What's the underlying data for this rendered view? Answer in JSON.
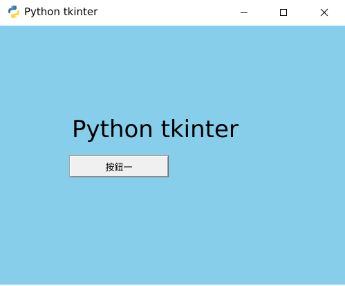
{
  "window": {
    "title": "Python tkinter",
    "icon": "python-logo-icon",
    "controls": {
      "minimize_icon": "minimize-icon",
      "maximize_icon": "maximize-icon",
      "close_icon": "close-icon"
    }
  },
  "content": {
    "heading": "Python tkinter",
    "button_label": "按鈕一"
  },
  "colors": {
    "background": "#87ceeb",
    "titlebar": "#ffffff",
    "button_face": "#f0f0f0",
    "python_blue": "#3776ab",
    "python_yellow": "#ffd43b"
  }
}
